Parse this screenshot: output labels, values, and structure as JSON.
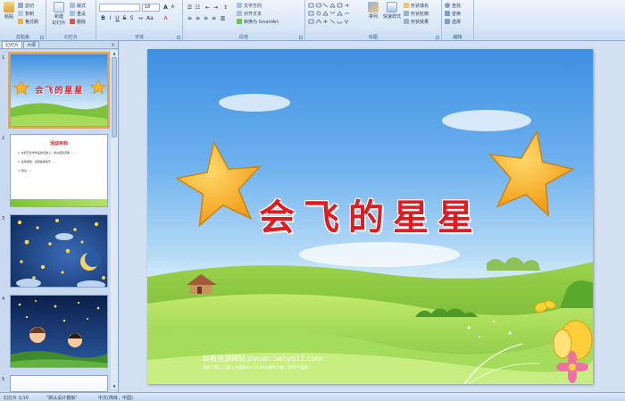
{
  "ribbon": {
    "clipboard": {
      "label": "剪贴板",
      "paste": "粘贴",
      "cut": "剪切",
      "copy": "复制",
      "format_painter": "格式刷"
    },
    "slides": {
      "label": "幻灯片",
      "new_slide": "新建",
      "new_slide_2": "幻灯片",
      "layout": "版式",
      "reset": "重设",
      "delete": "删除"
    },
    "font": {
      "label": "字体",
      "font_name": "",
      "font_size": "18"
    },
    "paragraph": {
      "label": "段落",
      "text_direction": "文字方向",
      "align_text": "对齐文本",
      "smartart": "转换为 SmartArt"
    },
    "drawing": {
      "label": "绘图",
      "arrange": "排列",
      "quick_styles": "快速样式",
      "shape_fill": "形状填充",
      "shape_outline": "形状轮廓",
      "shape_effects": "形状效果"
    },
    "editing": {
      "label": "编辑",
      "find": "查找",
      "replace": "替换",
      "select": "选择"
    }
  },
  "pane": {
    "tab_slides": "幻灯片",
    "tab_outline": "大纲",
    "close": "×",
    "thumbs": [
      {
        "num": "1",
        "title": "会飞的星星"
      },
      {
        "num": "2",
        "title": "活动目标",
        "lines": [
          "1. 在欣赏文学作品的基础上，通过感受诗歌……",
          "2. 喜欢星星，感受故事情节……",
          "3. 尝试……"
        ]
      },
      {
        "num": "3",
        "caption": ""
      },
      {
        "num": "4",
        "caption": ""
      },
      {
        "num": "5",
        "caption": ""
      }
    ]
  },
  "slide": {
    "title": "会飞的星星",
    "footer_site": "幼教资源网站  ziyuan.baby611.com",
    "footer_links": "课件下载  |  儿歌  |  合唱MP3  |  FLASH课件下载  |  试卷下载库"
  },
  "statusbar": {
    "slide_counter": "幻灯片 1/10",
    "theme": "\"默认设计模板\"",
    "language": "中文(简体，中国)"
  },
  "colors": {
    "ribbon_bg": "#dce8f7",
    "title_red": "#e11b22",
    "selection": "#f2a440",
    "sky": "#3d8fe2",
    "grass": "#7cc23a"
  }
}
